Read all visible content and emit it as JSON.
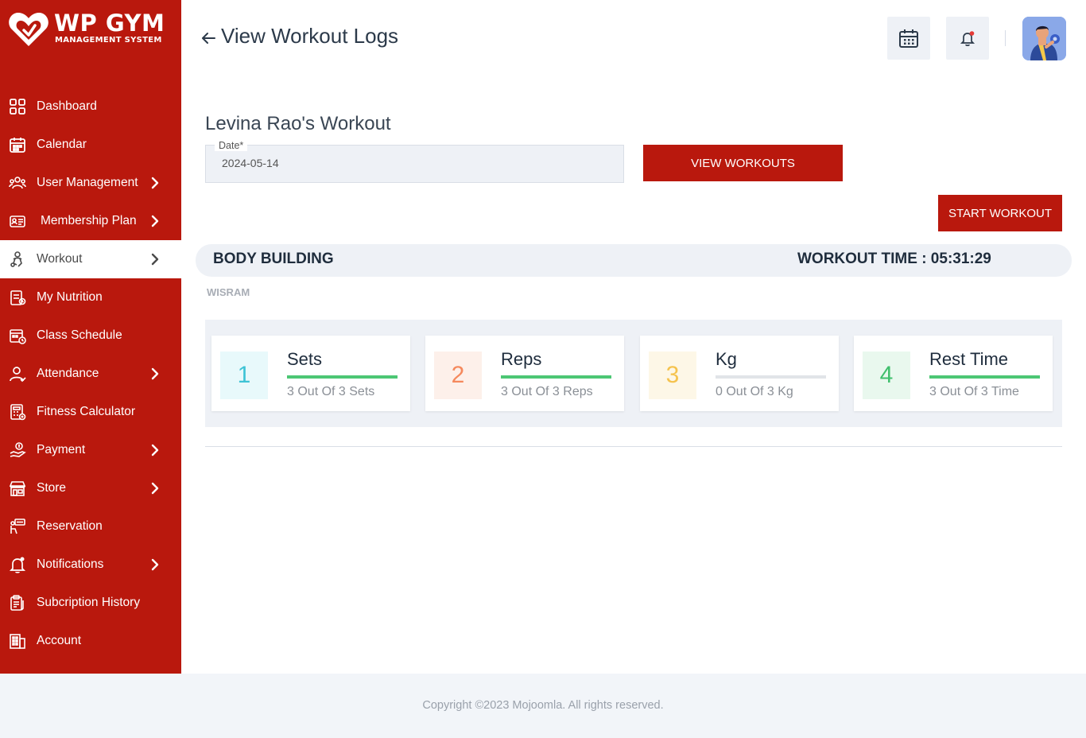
{
  "brand": {
    "title": "WP GYM",
    "subtitle": "MANAGEMENT SYSTEM",
    "color": "#b9180d"
  },
  "sidebar": {
    "items": [
      {
        "label": "Dashboard",
        "icon": "dashboard-grid-icon",
        "chevron": false,
        "active": false
      },
      {
        "label": "Calendar",
        "icon": "calendar-icon",
        "chevron": false,
        "active": false
      },
      {
        "label": "User Management",
        "icon": "users-gear-icon",
        "chevron": true,
        "active": false
      },
      {
        "label": "Membership Plan",
        "icon": "membership-card-icon",
        "chevron": true,
        "active": false
      },
      {
        "label": "Workout",
        "icon": "workout-icon",
        "chevron": true,
        "active": true
      },
      {
        "label": "My Nutrition",
        "icon": "nutrition-icon",
        "chevron": false,
        "active": false
      },
      {
        "label": "Class Schedule",
        "icon": "class-schedule-icon",
        "chevron": false,
        "active": false
      },
      {
        "label": "Attendance",
        "icon": "attendance-user-icon",
        "chevron": true,
        "active": false
      },
      {
        "label": "Fitness Calculator",
        "icon": "calculator-icon",
        "chevron": false,
        "active": false
      },
      {
        "label": "Payment",
        "icon": "payment-hand-icon",
        "chevron": true,
        "active": false
      },
      {
        "label": "Store",
        "icon": "store-icon",
        "chevron": true,
        "active": false
      },
      {
        "label": "Reservation",
        "icon": "reservation-icon",
        "chevron": false,
        "active": false
      },
      {
        "label": "Notifications",
        "icon": "bell-icon",
        "chevron": true,
        "active": false
      },
      {
        "label": "Subcription History",
        "icon": "subscription-history-icon",
        "chevron": false,
        "active": false
      },
      {
        "label": "Account",
        "icon": "account-building-icon",
        "chevron": false,
        "active": false
      }
    ]
  },
  "header": {
    "title": "View Workout Logs",
    "calendar_icon": "calendar-icon",
    "bell_icon": "bell-icon",
    "avatar": "user-avatar"
  },
  "main": {
    "member_title": "Levina Rao's Workout",
    "date_field": {
      "label": "Date*",
      "value": "2024-05-14"
    },
    "view_workouts_label": "VIEW WORKOUTS",
    "start_workout_label": "START WORKOUT",
    "workout": {
      "name": "BODY BUILDING",
      "time_label": "WORKOUT TIME : 05:31:29",
      "sub_label": "WISRAM"
    },
    "stats": [
      {
        "number": "1",
        "title": "Sets",
        "value": "3 Out Of 3 Sets",
        "progress": 1.0,
        "num_color": "#3ec3d5",
        "num_bg": "#e8f9fb"
      },
      {
        "number": "2",
        "title": "Reps",
        "value": "3 Out Of 3 Reps",
        "progress": 1.0,
        "num_color": "#f5895d",
        "num_bg": "#fdf0ea"
      },
      {
        "number": "3",
        "title": "Kg",
        "value": "0 Out Of 3 Kg",
        "progress": 0.0,
        "num_color": "#f5c34e",
        "num_bg": "#fdf7e7"
      },
      {
        "number": "4",
        "title": "Rest Time",
        "value": "3 Out Of 3 Time",
        "progress": 1.0,
        "num_color": "#3fbf6c",
        "num_bg": "#e9f8ee"
      }
    ]
  },
  "footer": {
    "text": "Copyright ©2023 Mojoomla. All rights reserved."
  }
}
